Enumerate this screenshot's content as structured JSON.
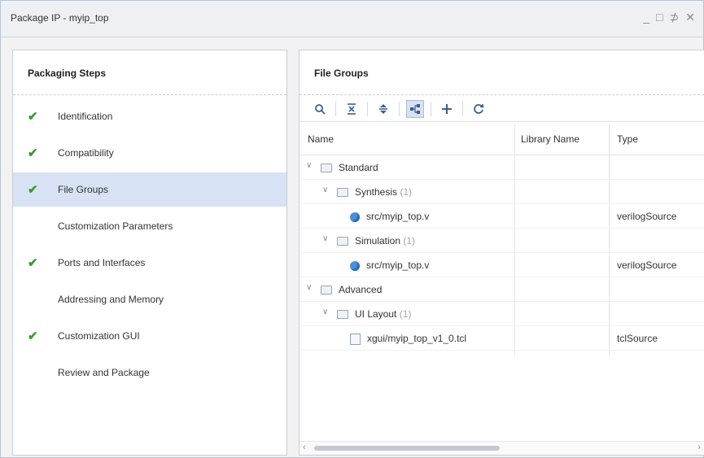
{
  "window": {
    "title": "Package IP - myip_top",
    "controls": [
      "_",
      "□",
      "⊅",
      "✕"
    ]
  },
  "left": {
    "header": "Packaging Steps",
    "steps": [
      {
        "label": "Identification",
        "checked": true
      },
      {
        "label": "Compatibility",
        "checked": true
      },
      {
        "label": "File Groups",
        "checked": true,
        "selected": true
      },
      {
        "label": "Customization Parameters",
        "checked": false
      },
      {
        "label": "Ports and Interfaces",
        "checked": true
      },
      {
        "label": "Addressing and Memory",
        "checked": false
      },
      {
        "label": "Customization GUI",
        "checked": true
      },
      {
        "label": "Review and Package",
        "checked": false
      }
    ],
    "check_glyph": "✔"
  },
  "right": {
    "header": "File Groups",
    "toolbar": {
      "icons": [
        "search-icon",
        "collapse-all-icon",
        "expand-all-icon",
        "hierarchy-icon",
        "add-icon",
        "refresh-icon"
      ]
    },
    "columns": {
      "name": "Name",
      "library": "Library Name",
      "type": "Type"
    },
    "rows": [
      {
        "name": "Standard",
        "count": "",
        "icon": "folder-icon",
        "library": "",
        "type": "",
        "level": 0,
        "chevron": "∨"
      },
      {
        "name": "Synthesis",
        "count": "(1)",
        "icon": "folder-icon",
        "library": "",
        "type": "",
        "level": 1,
        "chevron": "∨"
      },
      {
        "name": "src/myip_top.v",
        "count": "",
        "icon": "verilog-file-icon",
        "library": "",
        "type": "verilogSource",
        "level": 2,
        "chevron": ""
      },
      {
        "name": "Simulation",
        "count": "(1)",
        "icon": "folder-icon",
        "library": "",
        "type": "",
        "level": 1,
        "chevron": "∨"
      },
      {
        "name": "src/myip_top.v",
        "count": "",
        "icon": "verilog-file-icon",
        "library": "",
        "type": "verilogSource",
        "level": 2,
        "chevron": ""
      },
      {
        "name": "Advanced",
        "count": "",
        "icon": "folder-icon",
        "library": "",
        "type": "",
        "level": 0,
        "chevron": "∨"
      },
      {
        "name": "UI Layout",
        "count": "(1)",
        "icon": "folder-icon",
        "library": "",
        "type": "",
        "level": 1,
        "chevron": "∨"
      },
      {
        "name": "xgui/myip_top_v1_0.tcl",
        "count": "",
        "icon": "tcl-file-icon",
        "library": "",
        "type": "tclSource",
        "level": 2,
        "chevron": ""
      }
    ]
  },
  "colors": {
    "selected_row": "#d7e2f4",
    "check": "#3a9a2e",
    "accent": "#3b5f8c"
  }
}
